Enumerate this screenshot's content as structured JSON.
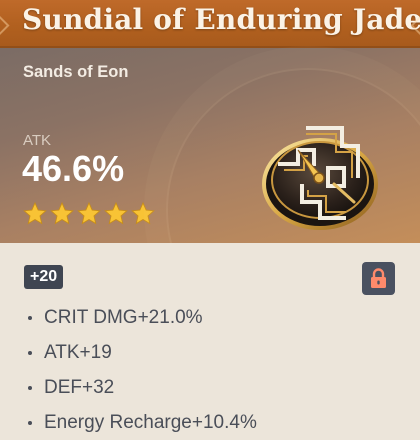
{
  "artifact": {
    "name": "Sundial of Enduring Jade",
    "slot": "Sands of Eon",
    "main_stat": {
      "label": "ATK",
      "value": "46.6%"
    },
    "rarity_stars": 5,
    "level": "+20",
    "locked": true,
    "substats": [
      "CRIT DMG+21.0%",
      "ATK+19",
      "DEF+32",
      "Energy Recharge+10.4%"
    ]
  },
  "icons": {
    "lock": "lock-icon",
    "star": "star-icon",
    "artifact": "sundial-artifact-icon"
  },
  "colors": {
    "title_bar": "#b1601f",
    "star": "#f8c335",
    "badge_bg": "#3f4551",
    "lock_bg": "#4a5160",
    "lock_icon": "#ff8a6b",
    "body_text": "#4a4e58",
    "body_bg": "#ece5da"
  }
}
